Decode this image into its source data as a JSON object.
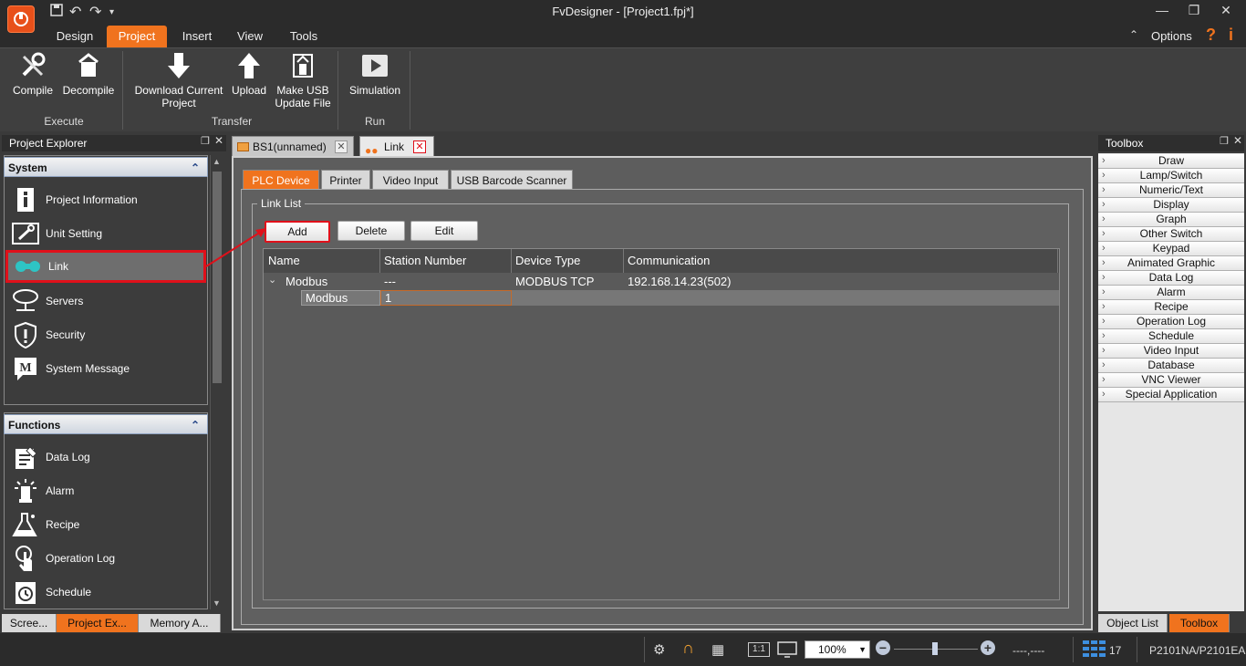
{
  "app": {
    "title": "FvDesigner - [Project1.fpj*]"
  },
  "menu": {
    "tabs": [
      "Design",
      "Project",
      "Insert",
      "View",
      "Tools"
    ],
    "options_label": "Options"
  },
  "ribbon": {
    "compile": "Compile",
    "decompile": "Decompile",
    "download_l1": "Download Current",
    "download_l2": "Project",
    "upload": "Upload",
    "usb_l1": "Make USB",
    "usb_l2": "Update File",
    "simulation": "Simulation",
    "group_execute": "Execute",
    "group_transfer": "Transfer",
    "group_run": "Run"
  },
  "project_explorer": {
    "title": "Project Explorer",
    "system_header": "System",
    "system_items": [
      "Project Information",
      "Unit Setting",
      "Link",
      "Servers",
      "Security",
      "System Message"
    ],
    "functions_header": "Functions",
    "function_items": [
      "Data Log",
      "Alarm",
      "Recipe",
      "Operation Log",
      "Schedule"
    ],
    "bottom_tabs": [
      "Scree...",
      "Project Ex...",
      "Memory A..."
    ]
  },
  "document_tabs": [
    "BS1(unnamed)",
    "Link"
  ],
  "link_page": {
    "tabs": [
      "PLC Device",
      "Printer",
      "Video Input",
      "USB Barcode Scanner"
    ],
    "group_label": "Link List",
    "buttons": {
      "add": "Add",
      "delete": "Delete",
      "edit": "Edit"
    },
    "columns": [
      "Name",
      "Station Number",
      "Device Type",
      "Communication"
    ],
    "rows": [
      {
        "name": "Modbus",
        "station": "---",
        "device": "MODBUS TCP",
        "comm": "192.168.14.23(502)"
      },
      {
        "name": "Modbus",
        "station": "1",
        "device": "",
        "comm": ""
      }
    ]
  },
  "toolbox": {
    "title": "Toolbox",
    "items": [
      "Draw",
      "Lamp/Switch",
      "Numeric/Text",
      "Display",
      "Graph",
      "Other Switch",
      "Keypad",
      "Animated Graphic",
      "Data Log",
      "Alarm",
      "Recipe",
      "Operation Log",
      "Schedule",
      "Video Input",
      "Database",
      "VNC Viewer",
      "Special Application"
    ],
    "bottom_tabs": [
      "Object List",
      "Toolbox"
    ]
  },
  "statusbar": {
    "zoom": "100%",
    "coords": "----,----",
    "grid_count": "17",
    "model": "P2101NA/P2101EA"
  },
  "colors": {
    "accent": "#f0731e",
    "highlight": "#e0101a"
  }
}
